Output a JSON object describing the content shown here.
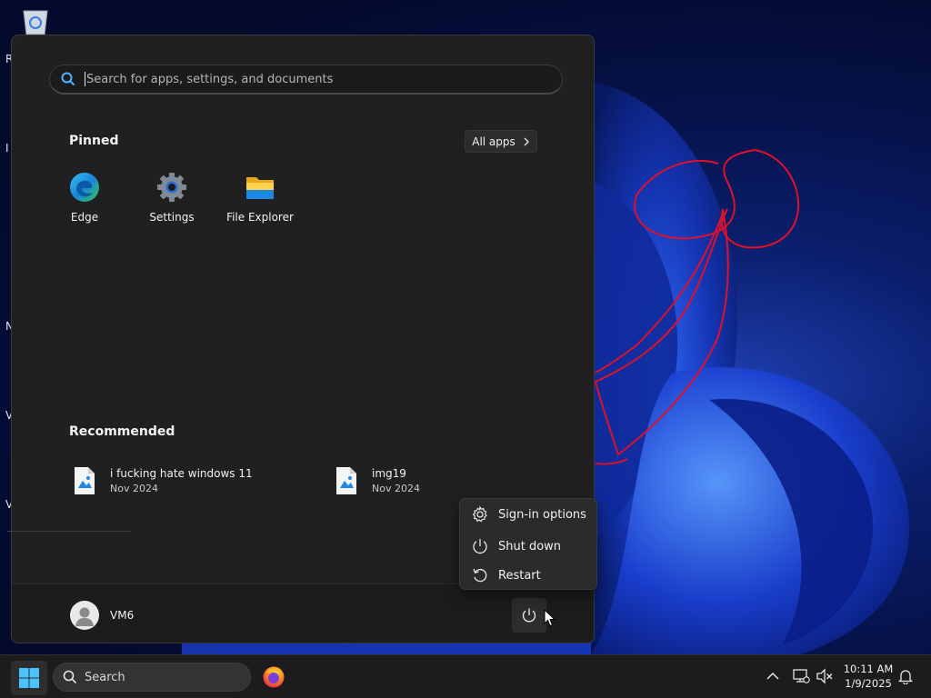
{
  "start_menu": {
    "search_placeholder": "Search for apps, settings, and documents",
    "pinned_title": "Pinned",
    "all_apps_label": "All apps",
    "pinned_apps": [
      {
        "label": "Edge",
        "icon": "edge-icon"
      },
      {
        "label": "Settings",
        "icon": "settings-gear-icon"
      },
      {
        "label": "File Explorer",
        "icon": "folder-icon"
      }
    ],
    "recommended_title": "Recommended",
    "recommended": [
      {
        "name": "i fucking hate windows 11",
        "date": "Nov 2024",
        "icon": "image-file-icon"
      },
      {
        "name": "img19",
        "date": "Nov 2024",
        "icon": "image-file-icon"
      }
    ],
    "user_name": "VM6"
  },
  "power_menu": {
    "items": [
      {
        "label": "Sign-in options",
        "icon": "gear-icon"
      },
      {
        "label": "Shut down",
        "icon": "power-icon"
      },
      {
        "label": "Restart",
        "icon": "restart-icon"
      }
    ]
  },
  "desktop": {
    "edge_letters": [
      "R",
      "I",
      "N",
      "V",
      "V"
    ]
  },
  "taskbar": {
    "search_label": "Search",
    "time": "10:11 AM",
    "date": "1/9/2025"
  },
  "colors": {
    "accent": "#0078d4",
    "annotation": "#e0102a",
    "menu_bg": "#202020"
  }
}
